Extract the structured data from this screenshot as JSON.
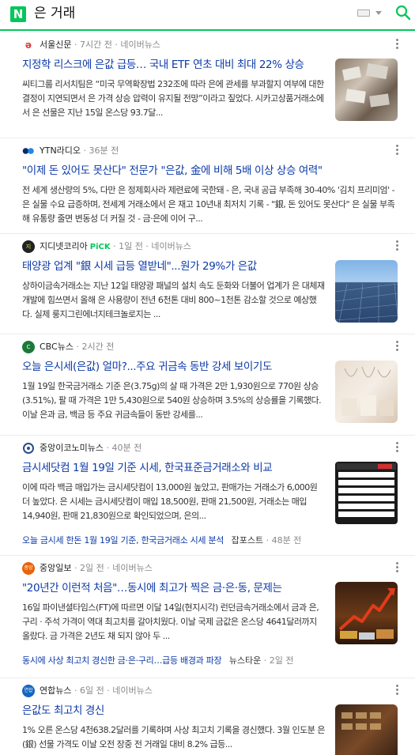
{
  "search": {
    "query": "은 거래"
  },
  "news": [
    {
      "press": "서울신문",
      "time": "· 7시간 전 ·",
      "portal": "네이버뉴스",
      "title": "지정학 리스크에 은값 급등… 국내 ETF 연초 대비 최대 22% 상승",
      "body": "씨티그룹 리서치팀은 “미국 무역확장법 232조에 따라 은에 관세를 부과할지 여부에 대한 결정이 지연되면서 은 가격 상승 압력이 유지될 전망”이라고 짚었다. 시카고상품거래소에서 은 선물은 지난 15일 온스당 93.7달..."
    },
    {
      "press": "YTN라디오",
      "time": "· 36분 전",
      "title": "\"이제 돈 있어도 못산다\" 전문가 \"은값, 金에 비해 5배 이상 상승 여력\"",
      "body": "전 세계 생산량의 5%, 다만 은 정제회사라 제련료에 국한돼 - 은, 국내 공급 부족해 30-40% '김치 프리미엄' - 은 실물 수요 급증하며, 전세계 거래소에서 은 재고 10년내 최저치 기록 - \"銀, 돈 있어도 못산다\" 은 실물 부족해 유통량 줄면 변동성 더 커질 것 - 금·은에 이어 구..."
    },
    {
      "press": "지디넷코리아",
      "pick": "PiCK",
      "time": "· 1일 전 ·",
      "portal": "네이버뉴스",
      "title": "태양광 업계 \"銀 시세 급등 열받네\"...원가 29%가 은값",
      "body": "상하이금속거래소는 지난 12일 태양광 패널의 설치 속도 둔화와 더불어 업계가 은 대체재 개발에 힘쓰면서 올해 은 사용량이 전년 6천톤 대비 800~1천톤 감소할 것으로 예상했다. 실제 룽지그린에너지테크놀로지는 ..."
    },
    {
      "press": "CBC뉴스",
      "time": "· 2시간 전",
      "title": "오늘 은시세(은값) 얼마?...주요 귀금속 동반 강세 보이기도",
      "body": "1월 19일 한국금거래소 기준 은(3.75g)의 살 때 가격은 2만 1,930원으로 770원 상승(3.51%), 팔 때 가격은 1만 5,430원으로 540원 상승하며 3.5%의 상승률을 기록했다. 이날 은과 금, 백금 등 주요 귀금속들이 동반 강세를..."
    },
    {
      "press": "중앙이코노미뉴스",
      "time": "· 40분 전",
      "title": "금시세닷컴 1월 19일 기준 시세, 한국표준금거래소와 비교",
      "body": "이에 따라 백금 매입가는 금시세닷컴이 13,000원 높았고, 판매가는 거래소가 6,000원 더 높았다. 은 시세는 금시세닷컴이 매입 18,500원, 판매 21,500원, 거래소는 매입 14,940원, 판매 21,830원으로 확인되었으며, 은의...",
      "sub": {
        "link": "오늘 금시세 한돈 1월 19일 기준, 한국금거래소 시세 분석",
        "press": "잡포스트",
        "time": "· 48분 전"
      }
    },
    {
      "press": "중앙일보",
      "time": "· 2일 전 ·",
      "portal": "네이버뉴스",
      "title": "\"20년간 이런적 처음\"…동시에 최고가 찍은 금·은·동, 문제는",
      "body": "16일 파이낸셜타임스(FT)에 따르면 이달 14일(현지시각) 런던금속거래소에서 금과 은, 구리 · 주석 가격이 역대 최고치를 갈아치웠다. 이날 국제 금값은 온스당 4641달러까지 올랐다. 금 가격은 2년도 채 되지 않아 두 ...",
      "sub": {
        "link": "동시에 사상 최고치 경신한 금·은·구리…급등 배경과 파장",
        "press": "뉴스타운",
        "time": "· 2일 전"
      }
    },
    {
      "press": "연합뉴스",
      "time": "· 6일 전 ·",
      "portal": "네이버뉴스",
      "title": "은값도 최고치 경신",
      "body": "1% 오른 온스당 4천638.2달러를 기록하며 사상 최고치 기록을 경신했다. 3월 인도분 은(銀) 선물 가격도 이날 오전 장중 전 거래일 대비 8.2% 급등..."
    }
  ],
  "colors": {
    "accent": "#03c75a",
    "title": "#0c3aa8"
  }
}
